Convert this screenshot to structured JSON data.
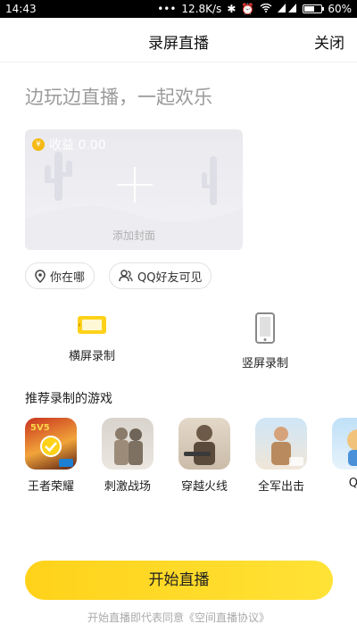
{
  "statusbar": {
    "time": "14:43",
    "speed": "12.8K/s",
    "battery": "60%",
    "battery_level": 0.6
  },
  "navbar": {
    "title": "录屏直播",
    "close_label": "关闭"
  },
  "slogan": "边玩边直播，一起欢乐",
  "cover": {
    "earnings_label": "收益 0.00",
    "coin_symbol": "¥",
    "add_cover_label": "添加封面"
  },
  "location_pill": {
    "label": "你在哪"
  },
  "visibility_pill": {
    "label": "QQ好友可见"
  },
  "modes": {
    "landscape": "横屏录制",
    "portrait": "竖屏录制"
  },
  "accent_color": "#ffd21a",
  "recommend_title": "推荐录制的游戏",
  "games": [
    {
      "name": "王者荣耀",
      "selected": true
    },
    {
      "name": "刺激战场",
      "selected": false
    },
    {
      "name": "穿越火线",
      "selected": false
    },
    {
      "name": "全军出击",
      "selected": false
    },
    {
      "name": "QQ",
      "selected": false
    }
  ],
  "start_button": "开始直播",
  "agreement": "开始直播即代表同意《空间直播协议》"
}
